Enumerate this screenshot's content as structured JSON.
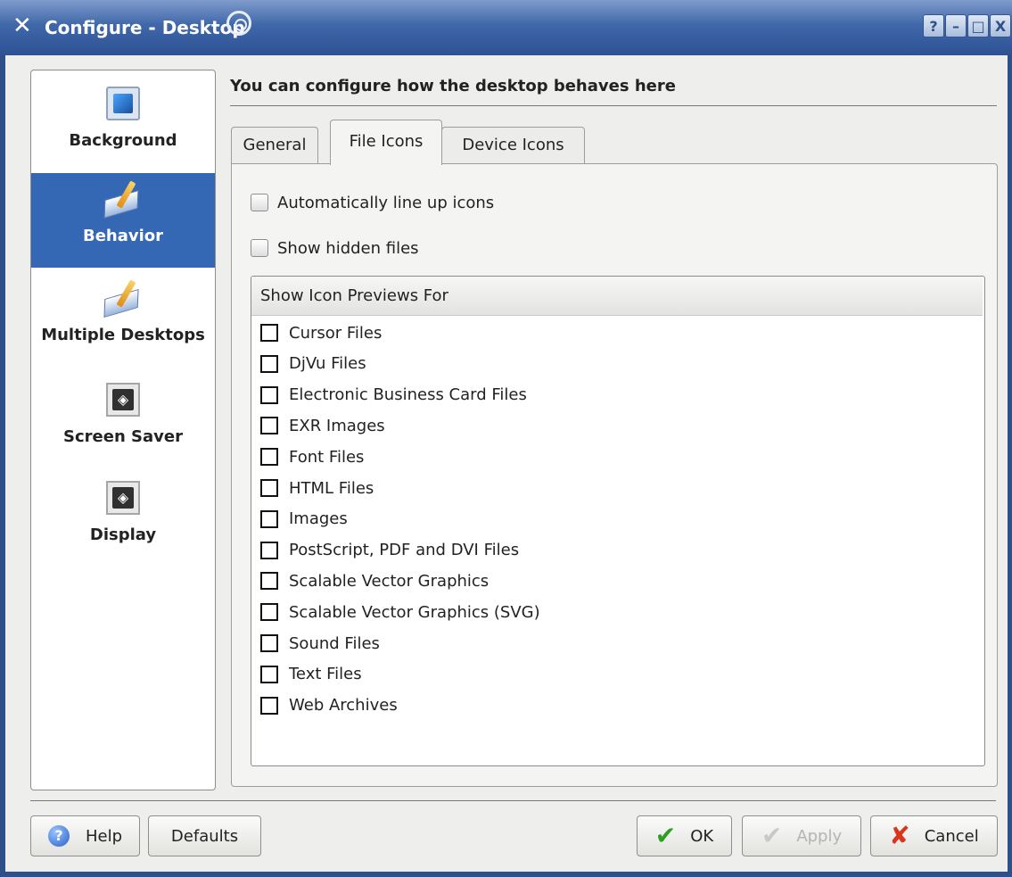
{
  "window": {
    "title": "Configure - Desktop",
    "app_icon": "kde-x-icon",
    "title_buttons": [
      "?",
      "–",
      "□",
      "X"
    ]
  },
  "sidebar": {
    "items": [
      {
        "label": "Background",
        "icon": "background-monitor-icon",
        "active": false
      },
      {
        "label": "Behavior",
        "icon": "desktop-pencil-icon",
        "active": true
      },
      {
        "label": "Multiple Desktops",
        "icon": "desktop-pencil-icon",
        "active": false
      },
      {
        "label": "Screen Saver",
        "icon": "screen-saver-monitor-icon",
        "active": false
      },
      {
        "label": "Display",
        "icon": "display-monitor-icon",
        "active": false
      }
    ]
  },
  "header": {
    "text": "You can configure how the desktop behaves here"
  },
  "tabs": [
    {
      "label": "General",
      "active": false
    },
    {
      "label": "File Icons",
      "active": true
    },
    {
      "label": "Device Icons",
      "active": false
    }
  ],
  "options": {
    "auto_lineup": {
      "label": "Automatically line up icons",
      "checked": false
    },
    "show_hidden": {
      "label": "Show hidden files",
      "checked": false
    }
  },
  "preview_list": {
    "header": "Show Icon Previews For",
    "items": [
      "Cursor Files",
      "DjVu Files",
      "Electronic Business Card Files",
      "EXR Images",
      "Font Files",
      "HTML Files",
      "Images",
      "PostScript, PDF and DVI Files",
      "Scalable Vector Graphics",
      "Scalable Vector Graphics (SVG)",
      "Sound Files",
      "Text Files",
      "Web Archives"
    ]
  },
  "buttons": {
    "help": "Help",
    "defaults": "Defaults",
    "ok": "OK",
    "apply": "Apply",
    "cancel": "Cancel"
  },
  "colors": {
    "titlebar": "#3f67a9",
    "selection": "#3467b4",
    "ok_check": "#2e9e22",
    "cancel_x": "#d8351c"
  }
}
